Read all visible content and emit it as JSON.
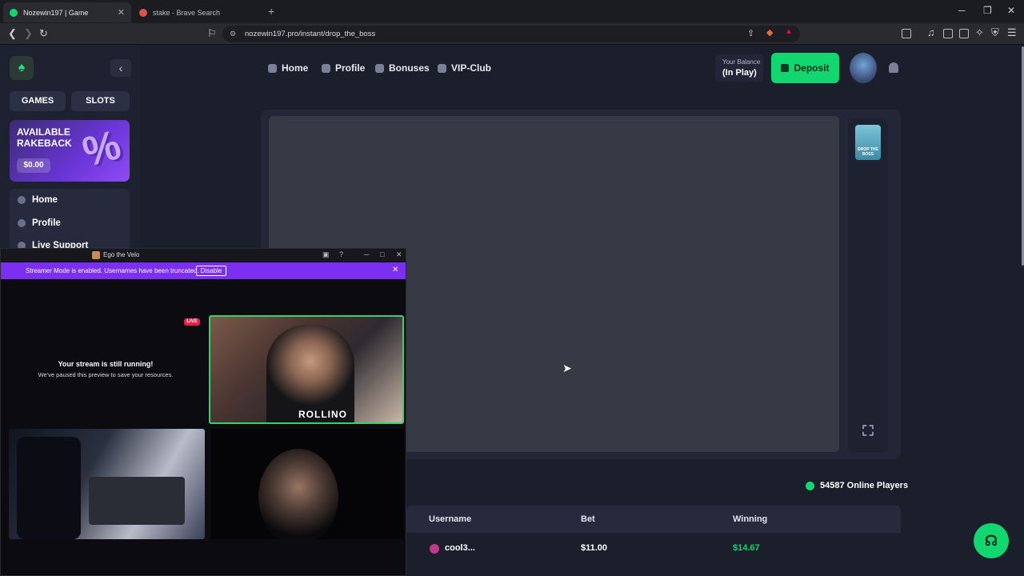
{
  "browser": {
    "tabs": [
      {
        "title": "Nozewin197 | Game",
        "active": true
      },
      {
        "title": "stake - Brave Search",
        "active": false
      }
    ],
    "url": "nozewin197.pro/instant/drop_the_boss",
    "window_controls": [
      "minimize",
      "maximize",
      "close"
    ]
  },
  "site": {
    "nav": {
      "home": "Home",
      "profile": "Profile",
      "bonuses": "Bonuses",
      "vip": "VIP-Club"
    },
    "balance": {
      "label": "Your Balance",
      "value": "(In Play)"
    },
    "deposit_label": "Deposit",
    "sidebar": {
      "games": "GAMES",
      "slots": "SLOTS",
      "rakeback": {
        "title": "AVAILABLE RAKEBACK",
        "amount": "$0.00",
        "symbol": "%"
      },
      "items": [
        {
          "label": "Home"
        },
        {
          "label": "Profile"
        },
        {
          "label": "Live Support"
        }
      ]
    },
    "game_thumb_label": "DROP THE BOSS",
    "online_players": "54587 Online Players",
    "table": {
      "headers": [
        "Username",
        "Bet",
        "Winning"
      ],
      "rows": [
        {
          "username": "cool3...",
          "bet": "$11.00",
          "winning": "$14.67"
        }
      ]
    },
    "colors": {
      "accent": "#12d670",
      "win": "#12d670",
      "background": "#1b1e2b"
    }
  },
  "overlay": {
    "title": "Ego the Velo",
    "banner": {
      "message": "Streamer Mode is enabled. Usernames have been truncated.",
      "action": "Disable"
    },
    "paused_title": "Your stream is still running!",
    "paused_sub": "We've paused this preview to save your resources.",
    "live_badge": "LIVE",
    "cam1_shirt": "ROLLINO"
  }
}
